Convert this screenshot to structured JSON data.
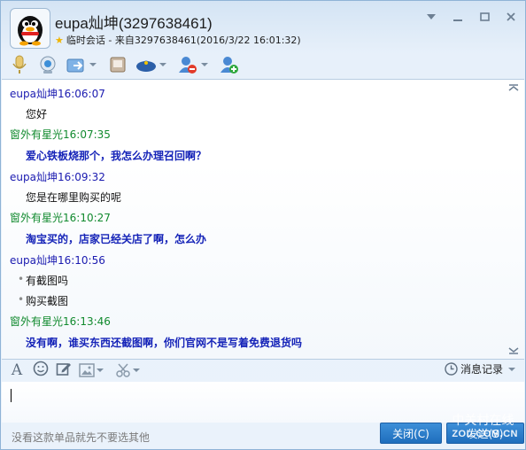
{
  "header": {
    "contact_name": "eupa灿坤(3297638461)",
    "subtitle": "临时会话 - 来自3297638461(2016/3/22 16:01:32)"
  },
  "toolbar": {
    "icons": [
      "microphone-icon",
      "webcam-icon",
      "send-file-icon",
      "screen-share-icon",
      "app-icon",
      "block-user-icon",
      "add-user-icon"
    ]
  },
  "messages": [
    {
      "sender": "eupa灿坤",
      "time": "16:06:07",
      "text": "您好"
    },
    {
      "sender": "窗外有星光",
      "time": "16:07:35",
      "text": "爱心铁板烧那个，我怎么办理召回啊？"
    },
    {
      "sender": "eupa灿坤",
      "time": "16:09:32",
      "text": "您是在哪里购买的呢"
    },
    {
      "sender": "窗外有星光",
      "time": "16:10:27",
      "text": "淘宝买的，店家已经关店了啊，怎么办"
    },
    {
      "sender": "eupa灿坤",
      "time": "16:10:56",
      "text1": "有截图吗",
      "text2": "购买截图"
    },
    {
      "sender": "窗外有星光",
      "time": "16:13:46",
      "text": "没有啊，谁买东西还截图啊，你们官网不是写着免费退货吗"
    }
  ],
  "input": {
    "history_label": "消息记录",
    "draft_hint": "没看这款单品就先不要选其他",
    "close_label": "关闭(C)",
    "send_label": "发送(S)"
  },
  "watermark": {
    "line1": "中关村在线",
    "line2": "ZOL.COM.CN"
  },
  "colors": {
    "accent": "#1f6ebd",
    "support_name": "#1a1ab0",
    "customer_name": "#118a2e",
    "customer_text": "#1624b8"
  }
}
